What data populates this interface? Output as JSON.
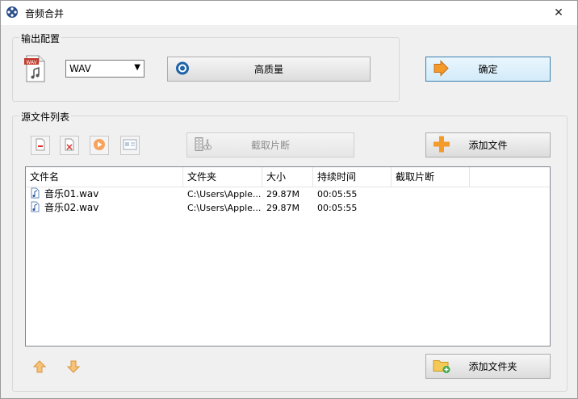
{
  "window": {
    "title": "音频合并",
    "close_glyph": "✕"
  },
  "output_config": {
    "legend": "输出配置",
    "format_icon_text": "WAV",
    "format_value": "WAV",
    "quality_label": "高质量"
  },
  "ok_label": "确定",
  "source_list": {
    "legend": "源文件列表",
    "cut_label": "截取片断",
    "add_file_label": "添加文件",
    "add_folder_label": "添加文件夹"
  },
  "table": {
    "columns": [
      "文件名",
      "文件夹",
      "大小",
      "持续时间",
      "截取片断"
    ],
    "rows": [
      {
        "name": "音乐01.wav",
        "folder": "C:\\Users\\Apple...",
        "size": "29.87M",
        "duration": "00:05:55",
        "cut": ""
      },
      {
        "name": "音乐02.wav",
        "folder": "C:\\Users\\Apple...",
        "size": "29.87M",
        "duration": "00:05:55",
        "cut": ""
      }
    ]
  },
  "colors": {
    "accent_orange": "#f39a2b",
    "primary_border": "#3c7fb1"
  }
}
